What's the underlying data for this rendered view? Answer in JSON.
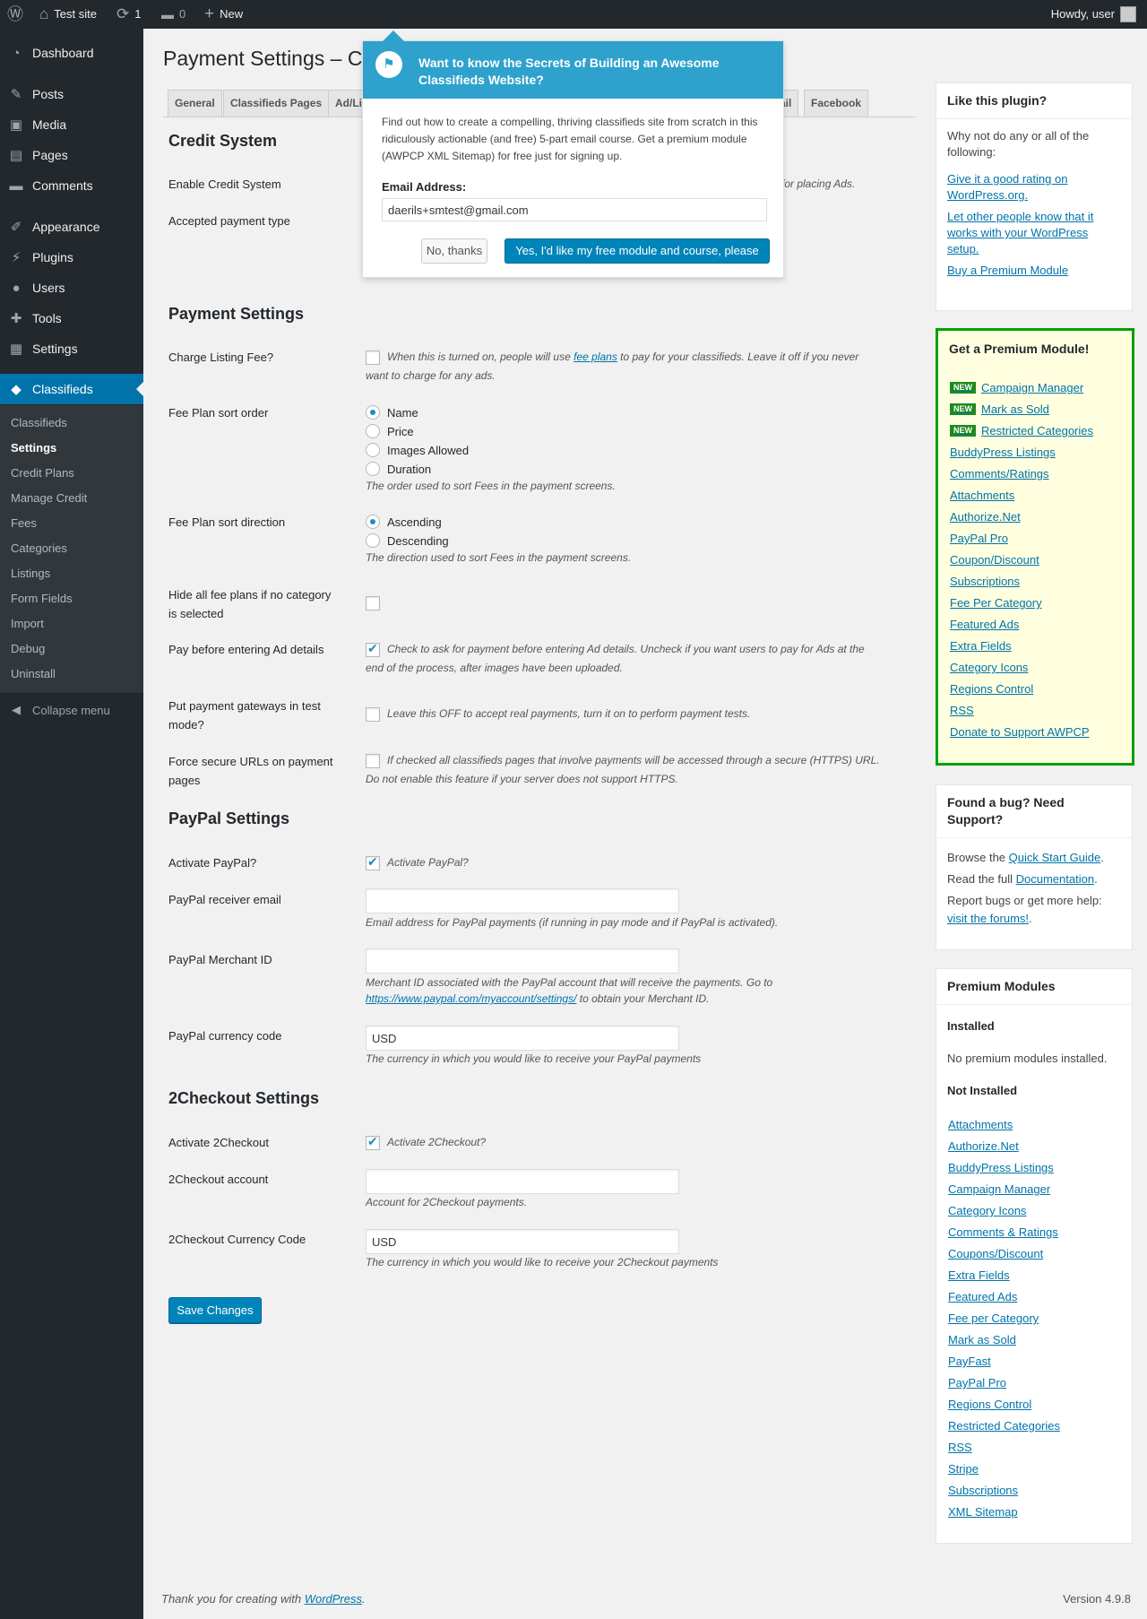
{
  "adminbar": {
    "wp_logo": "wordpress-icon",
    "site_name": "Test site",
    "updates_count": "1",
    "comments_count": "0",
    "new_label": "New",
    "howdy": "Howdy, user"
  },
  "sidebar": {
    "items": [
      {
        "label": "Dashboard",
        "icon": "dashboard-icon"
      },
      {
        "label": "Posts",
        "icon": "pin-icon"
      },
      {
        "label": "Media",
        "icon": "media-icon"
      },
      {
        "label": "Pages",
        "icon": "pages-icon"
      },
      {
        "label": "Comments",
        "icon": "comment-icon"
      },
      {
        "label": "Appearance",
        "icon": "brush-icon"
      },
      {
        "label": "Plugins",
        "icon": "plug-icon"
      },
      {
        "label": "Users",
        "icon": "user-icon"
      },
      {
        "label": "Tools",
        "icon": "wrench-icon"
      },
      {
        "label": "Settings",
        "icon": "settings-icon"
      },
      {
        "label": "Classifieds",
        "icon": "tag-icon"
      }
    ],
    "submenu": [
      "Classifieds",
      "Settings",
      "Credit Plans",
      "Manage Credit",
      "Fees",
      "Categories",
      "Listings",
      "Form Fields",
      "Import",
      "Debug",
      "Uninstall"
    ],
    "collapse": "Collapse menu"
  },
  "page": {
    "title": "Payment Settings – Cl",
    "tabs": [
      "General",
      "Classifieds Pages",
      "Ad/Li",
      "ail",
      "Facebook"
    ]
  },
  "credit": {
    "heading": "Credit System",
    "enable_label": "Enable Credit System",
    "enable_desc_tail": "for placing Ads.",
    "accepted_label": "Accepted payment type"
  },
  "payment": {
    "heading": "Payment Settings",
    "charge_label": "Charge Listing Fee?",
    "charge_desc_1": "When this is turned on, people will use ",
    "charge_link": "fee plans",
    "charge_desc_2": " to pay for your classifieds. Leave it off if you never",
    "charge_desc_3": "want to charge for any ads.",
    "sort_order_label": "Fee Plan sort order",
    "sort_order_options": [
      "Name",
      "Price",
      "Images Allowed",
      "Duration"
    ],
    "sort_order_desc": "The order used to sort Fees in the payment screens.",
    "sort_dir_label": "Fee Plan sort direction",
    "sort_dir_options": [
      "Ascending",
      "Descending"
    ],
    "sort_dir_desc": "The direction used to sort Fees in the payment screens.",
    "hide_label_1": "Hide all fee plans if no category",
    "hide_label_2": "is selected",
    "paybefore_label": "Pay before entering Ad details",
    "paybefore_desc_1": "Check to ask for payment before entering Ad details. Uncheck if you want users to pay for Ads at the",
    "paybefore_desc_2": "end of the process, after images have been uploaded.",
    "testmode_label_1": "Put payment gateways in test",
    "testmode_label_2": "mode?",
    "testmode_desc": "Leave this OFF to accept real payments, turn it on to perform payment tests.",
    "secure_label_1": "Force secure URLs on payment",
    "secure_label_2": "pages",
    "secure_desc_1": "If checked all classifieds pages that involve payments will be accessed through a secure (HTTPS) URL.",
    "secure_desc_2": "Do not enable this feature if your server does not support HTTPS."
  },
  "paypal": {
    "heading": "PayPal Settings",
    "activate_label": "Activate PayPal?",
    "activate_desc": "Activate PayPal?",
    "email_label": "PayPal receiver email",
    "email_value": "",
    "email_desc": "Email address for PayPal payments (if running in pay mode and if PayPal is activated).",
    "merchant_label": "PayPal Merchant ID",
    "merchant_value": "",
    "merchant_desc_1": "Merchant ID associated with the PayPal account that will receive the payments. Go to",
    "merchant_link": "https://www.paypal.com/myaccount/settings/",
    "merchant_desc_2": " to obtain your Merchant ID.",
    "currency_label": "PayPal currency code",
    "currency_value": "USD",
    "currency_desc": "The currency in which you would like to receive your PayPal payments"
  },
  "twocheckout": {
    "heading": "2Checkout Settings",
    "activate_label": "Activate 2Checkout",
    "activate_desc": "Activate 2Checkout?",
    "account_label": "2Checkout account",
    "account_value": "",
    "account_desc": "Account for 2Checkout payments.",
    "currency_label": "2Checkout Currency Code",
    "currency_value": "USD",
    "currency_desc": "The currency in which you would like to receive your 2Checkout payments"
  },
  "save_label": "Save Changes",
  "footer": {
    "thanks_1": "Thank you for creating with ",
    "thanks_link": "WordPress",
    "thanks_2": ".",
    "version": "Version 4.9.8"
  },
  "popup": {
    "title": "Want to know the Secrets of Building an Awesome Classifieds Website?",
    "body": "Find out how to create a compelling, thriving classifieds site from scratch in this ridiculously actionable (and free) 5-part email course. Get a premium module (AWPCP XML Sitemap) for free just for signing up.",
    "email_label": "Email Address:",
    "email_value": "daerils+smtest@gmail.com",
    "no_label": "No, thanks",
    "yes_label": "Yes, I'd like my free module and course, please"
  },
  "widgets": {
    "like": {
      "title": "Like this plugin?",
      "intro": "Why not do any or all of the following:",
      "links": [
        "Give it a good rating on WordPress.org.",
        "Let other people know that it works with your WordPress setup.",
        "Buy a Premium Module"
      ]
    },
    "premium": {
      "title": "Get a Premium Module!",
      "new_badge": "NEW",
      "items": [
        {
          "label": "Campaign Manager",
          "is_new": true
        },
        {
          "label": "Mark as Sold",
          "is_new": true
        },
        {
          "label": "Restricted Categories",
          "is_new": true
        },
        {
          "label": "BuddyPress Listings",
          "is_new": false
        },
        {
          "label": "Comments/Ratings",
          "is_new": false
        },
        {
          "label": "Attachments",
          "is_new": false
        },
        {
          "label": "Authorize.Net",
          "is_new": false
        },
        {
          "label": "PayPal Pro",
          "is_new": false
        },
        {
          "label": "Coupon/Discount",
          "is_new": false
        },
        {
          "label": "Subscriptions",
          "is_new": false
        },
        {
          "label": "Fee Per Category",
          "is_new": false
        },
        {
          "label": "Featured Ads",
          "is_new": false
        },
        {
          "label": "Extra Fields",
          "is_new": false
        },
        {
          "label": "Category Icons",
          "is_new": false
        },
        {
          "label": "Regions Control",
          "is_new": false
        },
        {
          "label": "RSS",
          "is_new": false
        },
        {
          "label": "Donate to Support AWPCP",
          "is_new": false
        }
      ]
    },
    "bug": {
      "title": "Found a bug? Need Support?",
      "line1_pre": "Browse the ",
      "line1_link": "Quick Start Guide",
      "line1_post": ".",
      "line2_pre": "Read the full ",
      "line2_link": "Documentation",
      "line2_post": ".",
      "line3_pre": "Report bugs or get more help: ",
      "line3_link": "visit the forums!",
      "line3_post": "."
    },
    "modules": {
      "title": "Premium Modules",
      "installed_heading": "Installed",
      "installed_text": "No premium modules installed.",
      "not_installed_heading": "Not Installed",
      "not_installed": [
        "Attachments",
        "Authorize.Net",
        "BuddyPress Listings",
        "Campaign Manager",
        "Category Icons",
        "Comments & Ratings",
        "Coupons/Discount",
        "Extra Fields",
        "Featured Ads",
        "Fee per Category",
        "Mark as Sold",
        "PayFast",
        "PayPal Pro",
        "Regions Control",
        "Restricted Categories",
        "RSS",
        "Stripe",
        "Subscriptions",
        "XML Sitemap"
      ]
    }
  }
}
